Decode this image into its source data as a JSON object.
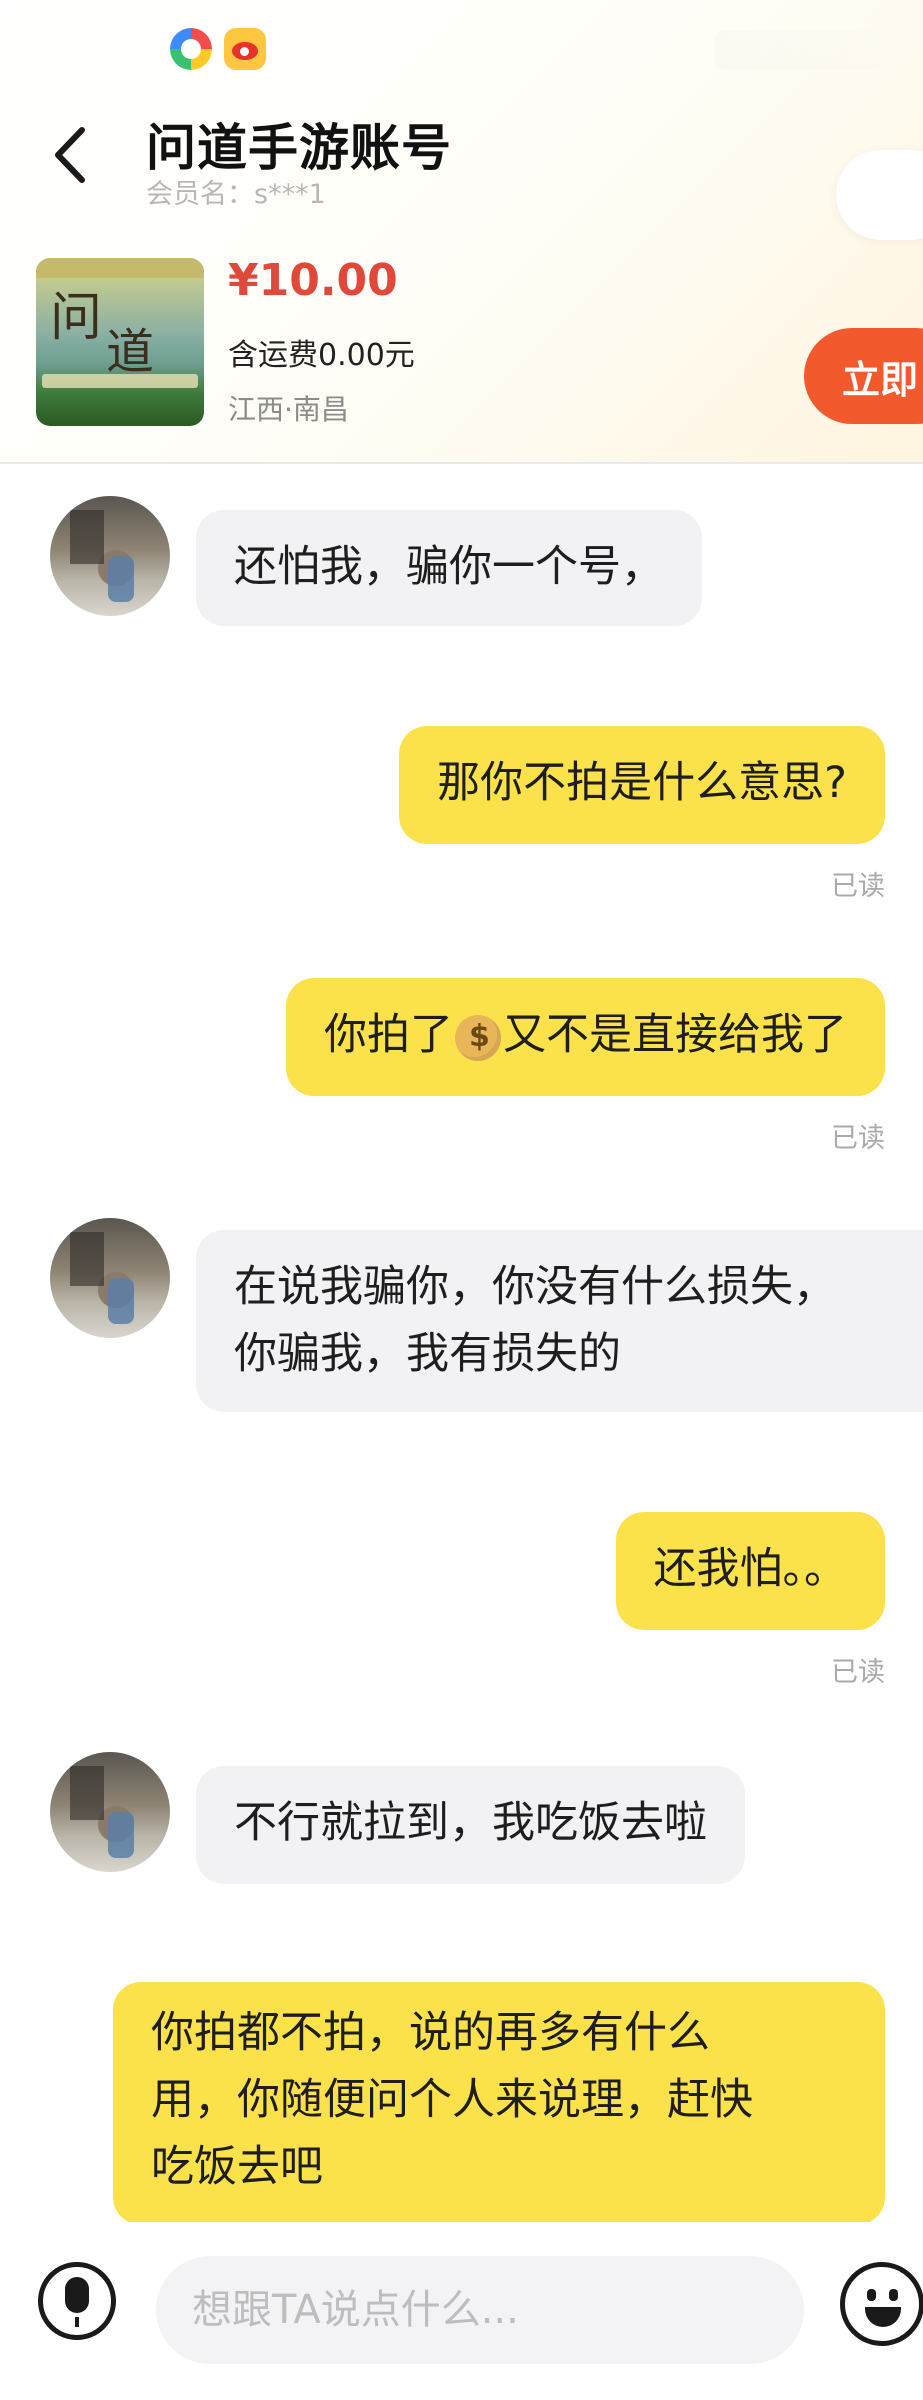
{
  "header": {
    "title": "问道手游账号",
    "member": "会员名：s***1"
  },
  "product": {
    "price": "¥10.00",
    "shipping": "含运费0.00元",
    "location": "江西·南昌",
    "buy_label": "立即"
  },
  "messages": [
    {
      "from": "other",
      "text": "还怕我，骗你一个号，"
    },
    {
      "from": "me",
      "text": "那你不拍是什么意思?",
      "status": "已读"
    },
    {
      "from": "me",
      "text_before": "你拍了",
      "emoji": "money-bag",
      "text_after": "又不是直接给我了",
      "status": "已读"
    },
    {
      "from": "other",
      "lines": [
        "在说我骗你，你没有什么损失，",
        "你骗我，我有损失的"
      ]
    },
    {
      "from": "me",
      "text": "还我怕。。",
      "status": "已读"
    },
    {
      "from": "other",
      "text": "不行就拉到，我吃饭去啦"
    },
    {
      "from": "me",
      "lines": [
        "你拍都不拍，说的再多有什么",
        "用，你随便问个人来说理，赶快",
        "吃饭去吧"
      ]
    }
  ],
  "composer": {
    "placeholder": "想跟TA说点什么...",
    "value": ""
  },
  "colors": {
    "accent_price": "#e0483b",
    "buy_button": "#f2592c",
    "my_bubble": "#fbe24a",
    "their_bubble": "#f2f2f4"
  },
  "icons": [
    "app-icon-colorful",
    "weibo-icon",
    "back-icon",
    "avatar",
    "money-bag-emoji",
    "microphone-icon",
    "smile-emoji-icon"
  ]
}
